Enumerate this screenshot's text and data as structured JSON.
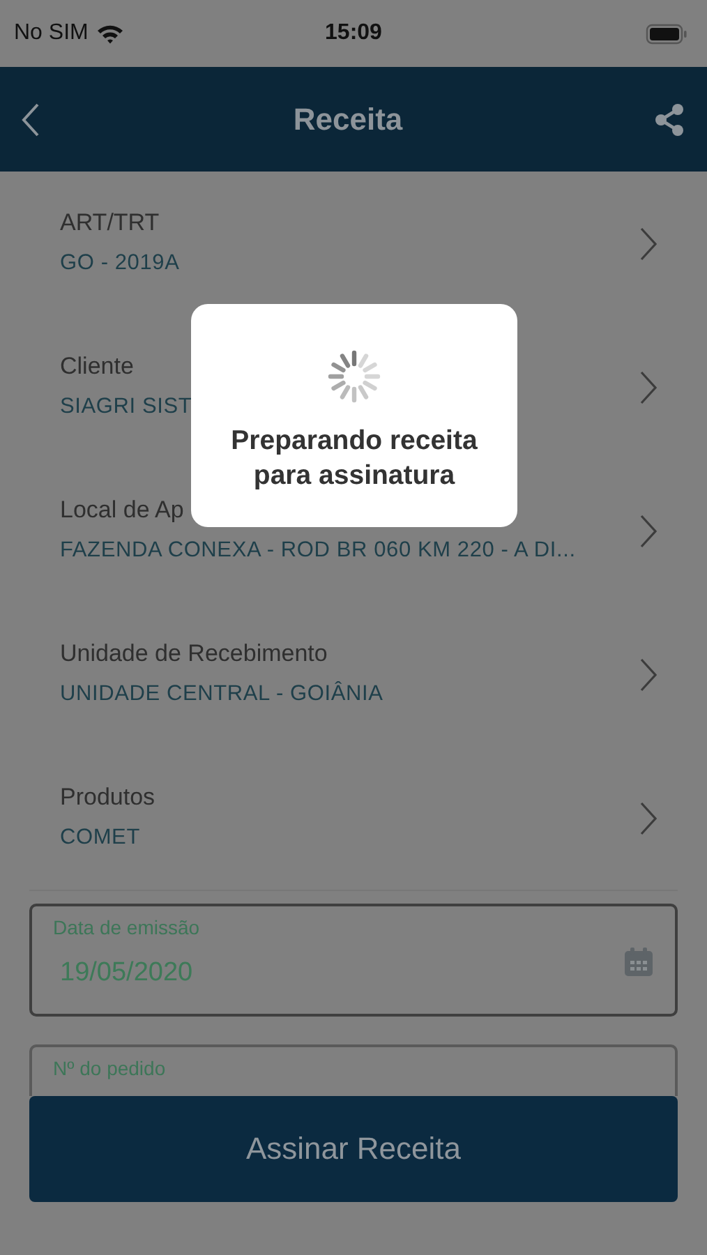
{
  "status_bar": {
    "carrier": "No SIM",
    "time": "15:09"
  },
  "nav": {
    "title": "Receita"
  },
  "rows": [
    {
      "label": "ART/TRT",
      "value": "GO - 2019A"
    },
    {
      "label": "Cliente",
      "value": "SIAGRI SIST"
    },
    {
      "label": "Local de Ap",
      "value": "FAZENDA CONEXA - ROD BR 060 KM 220 - A DI..."
    },
    {
      "label": "Unidade de Recebimento",
      "value": "UNIDADE CENTRAL - GOIÂNIA"
    },
    {
      "label": "Produtos",
      "value": "COMET"
    }
  ],
  "fields": [
    {
      "kind": "date",
      "label": "Data de emissão",
      "value": "19/05/2020"
    },
    {
      "kind": "text",
      "label": "Nº do pedido"
    }
  ],
  "button": {
    "label": "Assinar Receita"
  },
  "loading": {
    "message": "Preparando receita para assinatura"
  }
}
